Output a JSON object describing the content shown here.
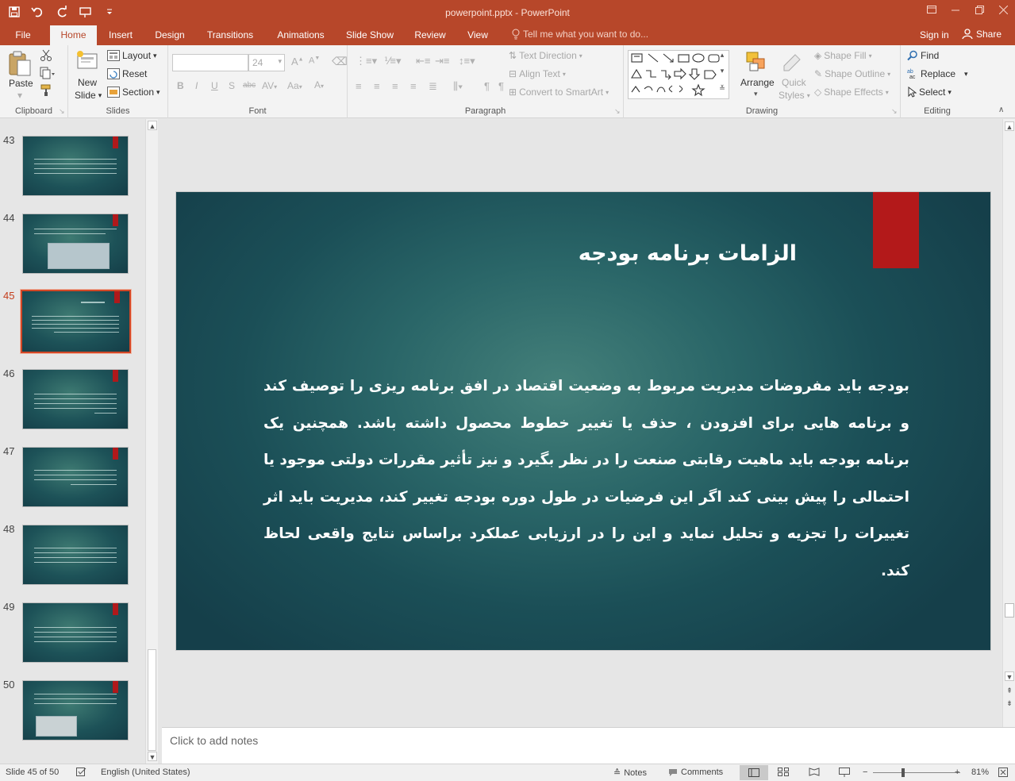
{
  "colors": {
    "brand": "#b7472a",
    "selection": "#d24726",
    "slide_bookmark": "#b3191a",
    "slide_bg": "#1f5a5e"
  },
  "titlebar": {
    "doc_title": "powerpoint.pptx - PowerPoint"
  },
  "qat": {
    "icons": [
      "save-icon",
      "undo-icon",
      "redo-icon",
      "start-from-beginning-icon",
      "customize-icon"
    ]
  },
  "tabs": [
    "File",
    "Home",
    "Insert",
    "Design",
    "Transitions",
    "Animations",
    "Slide Show",
    "Review",
    "View"
  ],
  "tellme": "Tell me what you want to do...",
  "account": {
    "signin": "Sign in",
    "share": "Share"
  },
  "ribbon": {
    "clipboard": {
      "label": "Clipboard",
      "paste": "Paste"
    },
    "slides": {
      "label": "Slides",
      "new_slide_1": "New",
      "new_slide_2": "Slide",
      "layout": "Layout",
      "reset": "Reset",
      "section": "Section"
    },
    "font": {
      "label": "Font",
      "size": "24"
    },
    "paragraph": {
      "label": "Paragraph",
      "text_direction": "Text Direction",
      "align_text": "Align Text",
      "smartart": "Convert to SmartArt"
    },
    "drawing": {
      "label": "Drawing",
      "arrange": "Arrange",
      "quick_styles_1": "Quick",
      "quick_styles_2": "Styles",
      "shape_fill": "Shape Fill",
      "shape_outline": "Shape Outline",
      "shape_effects": "Shape Effects"
    },
    "editing": {
      "label": "Editing",
      "find": "Find",
      "replace": "Replace",
      "select": "Select"
    }
  },
  "thumbnails": [
    {
      "num": "43",
      "selected": false
    },
    {
      "num": "44",
      "selected": false
    },
    {
      "num": "45",
      "selected": true
    },
    {
      "num": "46",
      "selected": false
    },
    {
      "num": "47",
      "selected": false
    },
    {
      "num": "48",
      "selected": false
    },
    {
      "num": "49",
      "selected": false
    },
    {
      "num": "50",
      "selected": false
    }
  ],
  "slide": {
    "title": "الزامات برنامه بودجه",
    "body": "بودجه باید مفروضات مدیریت مربوط به وضعیت اقتصاد در افق برنامه ریزی را توصیف کند و برنامه هایی برای افزودن ، حذف یا تغییر خطوط محصول داشته باشد. همچنین یک برنامه بودجه باید ماهیت رقابتی صنعت را در نظر بگیرد و نیز تأثیر مقررات دولتی موجود یا احتمالی را پیش بینی کند اگر این فرضیات در طول دوره بودجه تغییر کند، مدیریت باید اثر تغییرات را تجزیه و تحلیل نماید و این را در ارزیابی عملکرد براساس نتایج واقعی لحاظ کند."
  },
  "notes": {
    "placeholder": "Click to add notes"
  },
  "status": {
    "slide_info": "Slide 45 of 50",
    "language": "English (United States)",
    "notes": "Notes",
    "comments": "Comments",
    "zoom": "81%"
  }
}
